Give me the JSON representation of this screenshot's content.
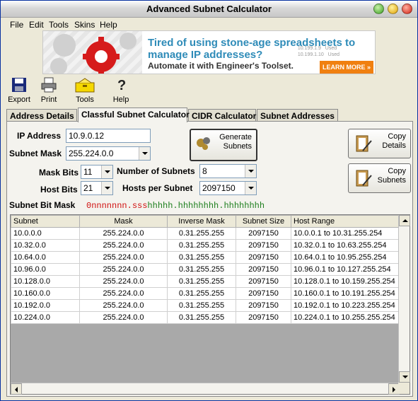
{
  "window": {
    "title": "Advanced Subnet Calculator"
  },
  "menu": [
    "File",
    "Edit",
    "Tools",
    "Skins",
    "Help"
  ],
  "banner": {
    "headline_line1": "Tired of using stone-age spreadsheets to",
    "headline_line2": "manage IP addresses?",
    "subline": "Automate it with Engineer's Toolset.",
    "button": "LEARN MORE »",
    "deco_lines": [
      "10.199.1.9",
      "10.199.1.10"
    ],
    "deco_used": "Used"
  },
  "toolbar": {
    "export": "Export",
    "print": "Print",
    "tools": "Tools",
    "help": "Help"
  },
  "tabs": [
    "Address Details",
    "Classful Subnet Calculator",
    "CIDR Calculator",
    "Subnet Addresses"
  ],
  "form": {
    "ip_label": "IP Address",
    "ip_value": "10.9.0.12",
    "mask_label": "Subnet Mask",
    "mask_value": "255.224.0.0",
    "maskbits_label": "Mask Bits",
    "maskbits_value": "11",
    "numsubnets_label": "Number of Subnets",
    "numsubnets_value": "8",
    "hostbits_label": "Host Bits",
    "hostbits_value": "21",
    "hostspersubnet_label": "Hosts per Subnet",
    "hostspersubnet_value": "2097150",
    "bitmask_label": "Subnet Bit Mask",
    "bitmask_net": "0nnnnnnn.",
    "bitmask_sub": "sss",
    "bitmask_host": "hhhhh.hhhhhhhh.hhhhhhhh"
  },
  "buttons": {
    "generate": [
      "Generate",
      "Subnets"
    ],
    "copy_details": [
      "Copy",
      "Details"
    ],
    "copy_subnets": [
      "Copy",
      "Subnets"
    ]
  },
  "table": {
    "columns": [
      "Subnet",
      "Mask",
      "Inverse Mask",
      "Subnet Size",
      "Host Range"
    ],
    "rows": [
      [
        "10.0.0.0",
        "255.224.0.0",
        "0.31.255.255",
        "2097150",
        "10.0.0.1  to  10.31.255.254"
      ],
      [
        "10.32.0.0",
        "255.224.0.0",
        "0.31.255.255",
        "2097150",
        "10.32.0.1  to  10.63.255.254"
      ],
      [
        "10.64.0.0",
        "255.224.0.0",
        "0.31.255.255",
        "2097150",
        "10.64.0.1  to  10.95.255.254"
      ],
      [
        "10.96.0.0",
        "255.224.0.0",
        "0.31.255.255",
        "2097150",
        "10.96.0.1  to  10.127.255.254"
      ],
      [
        "10.128.0.0",
        "255.224.0.0",
        "0.31.255.255",
        "2097150",
        "10.128.0.1  to  10.159.255.254"
      ],
      [
        "10.160.0.0",
        "255.224.0.0",
        "0.31.255.255",
        "2097150",
        "10.160.0.1  to  10.191.255.254"
      ],
      [
        "10.192.0.0",
        "255.224.0.0",
        "0.31.255.255",
        "2097150",
        "10.192.0.1  to  10.223.255.254"
      ],
      [
        "10.224.0.0",
        "255.224.0.0",
        "0.31.255.255",
        "2097150",
        "10.224.0.1  to  10.255.255.254"
      ]
    ]
  }
}
